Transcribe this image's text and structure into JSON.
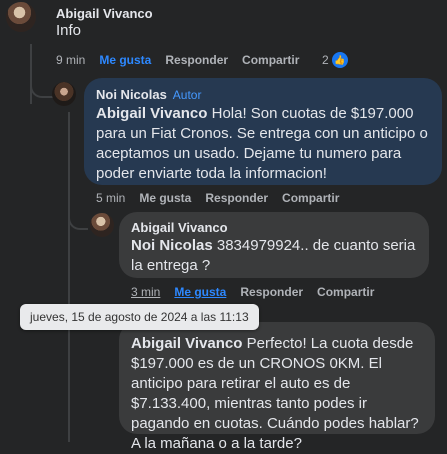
{
  "comments": [
    {
      "author": "Abigail Vivanco",
      "text": "Info",
      "time": "9 min",
      "like_label": "Me gusta",
      "reply_label": "Responder",
      "share_label": "Compartir",
      "reaction_count": "2"
    },
    {
      "author": "Noi Nicolas",
      "badge": "Autor",
      "mention": "Abigail Vivanco",
      "text": " Hola! Son cuotas de $197.000 para un Fiat Cronos. Se entrega con un anticipo o aceptamos un usado. Dejame tu numero para poder enviarte toda la informacion!",
      "time": "5 min",
      "like_label": "Me gusta",
      "reply_label": "Responder",
      "share_label": "Compartir"
    },
    {
      "author": "Abigail Vivanco",
      "mention": "Noi Nicolas",
      "text": " 3834979924.. de cuanto seria la entrega ?",
      "time": "3 min",
      "like_label": "Me gusta",
      "reply_label": "Responder",
      "share_label": "Compartir"
    },
    {
      "mention": "Abigail Vivanco",
      "text": " Perfecto! La cuota desde $197.000 es de un CRONOS 0KM. El anticipo para retirar el auto es de $7.133.400, mientras tanto podes ir pagando en cuotas. Cuándo podes hablar? A la mañana o a la tarde?"
    }
  ],
  "tooltip": "jueves, 15 de agosto de 2024 a las 11:13",
  "colors": {
    "background": "#242526",
    "bubble": "#3a3b3c",
    "highlight_bubble": "#263951",
    "link_blue": "#2d88ff"
  }
}
